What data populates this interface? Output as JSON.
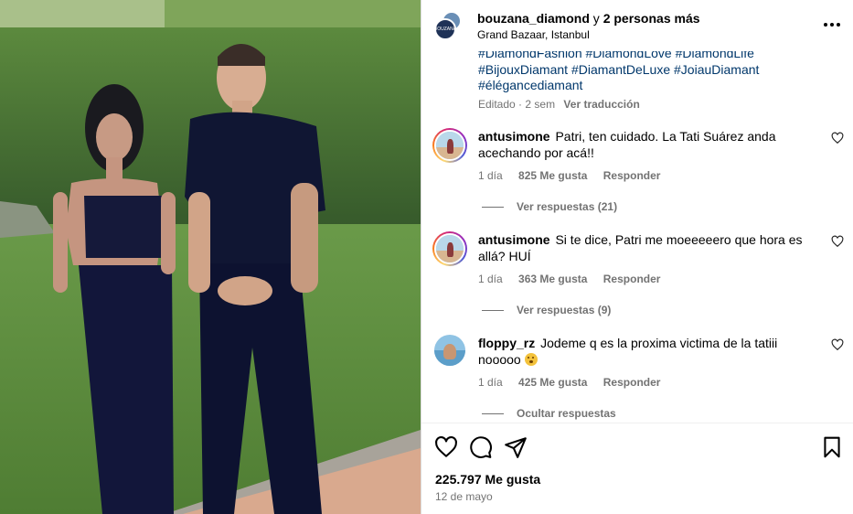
{
  "post": {
    "author": "bouzana_diamond",
    "collab_connector": "y",
    "collab_others": "2 personas más",
    "location": "Grand Bazaar, Istanbul",
    "avatar_badge": "BOUZANA"
  },
  "caption": {
    "hashtags": [
      "#DiamondFashion",
      "#DiamondLove",
      "#DiamondLife",
      "#BijouxDiamant",
      "#DiamantDeLuxe",
      "#JoiauDiamant",
      "#élégancediamant"
    ],
    "edited_label": "Editado",
    "separator": "·",
    "age": "2 sem",
    "translate_label": "Ver traducción"
  },
  "comments": [
    {
      "username": "antusimone",
      "text": "Patri, ten cuidado. La Tati Suárez anda acechando por acá!!",
      "time": "1 día",
      "likes": "825 Me gusta",
      "reply_label": "Responder",
      "replies_label": "Ver respuestas (21)"
    },
    {
      "username": "antusimone",
      "text": "Si te dice, Patri me moeeeeero que hora es allá? HUÍ",
      "time": "1 día",
      "likes": "363 Me gusta",
      "reply_label": "Responder",
      "replies_label": "Ver respuestas (9)"
    },
    {
      "username": "floppy_rz",
      "text": "Jodeme q es la proxima victima de la tatiii nooooo",
      "time": "1 día",
      "likes": "425 Me gusta",
      "reply_label": "Responder",
      "replies_label": "Ocultar respuestas"
    }
  ],
  "footer": {
    "likes_total": "225.797 Me gusta",
    "date": "12 de mayo"
  },
  "icons": {
    "more": "more-options-icon",
    "like": "heart-icon",
    "comment": "comment-icon",
    "share": "share-icon",
    "save": "bookmark-icon"
  },
  "colors": {
    "hashtag": "#00376b",
    "secondary_text": "#737373",
    "divider": "#dbdbdb"
  }
}
